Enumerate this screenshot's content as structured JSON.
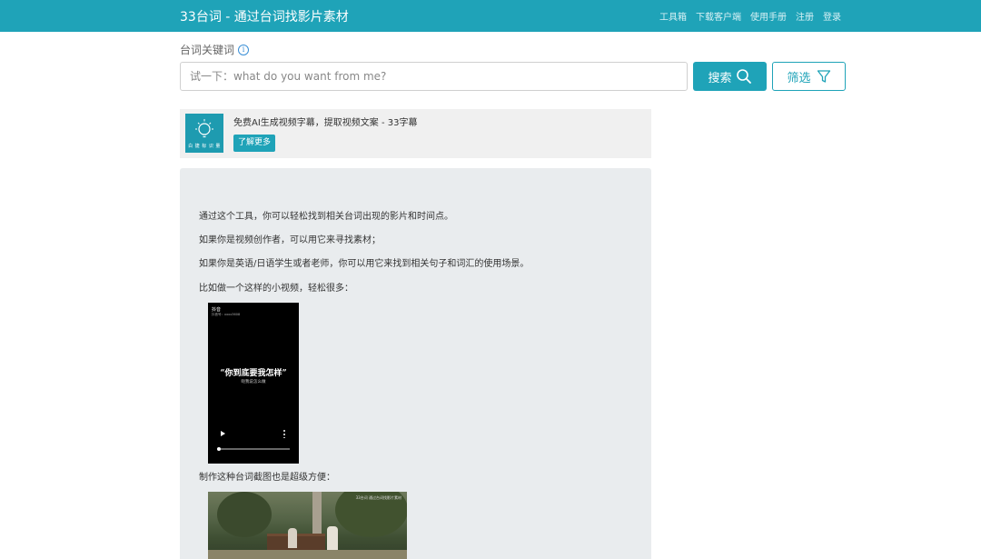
{
  "header": {
    "brand": "33台词 - 通过台词找影片素材",
    "nav": [
      "工具箱",
      "下载客户端",
      "使用手册",
      "注册",
      "登录"
    ]
  },
  "search": {
    "label": "台词关键词",
    "placeholder": "试一下：what do you want from me?",
    "search_button": "搜索",
    "filter_button": "筛选"
  },
  "ad": {
    "text": "免费AI生成视频字幕，提取视频文案 - 33字幕",
    "button": "了解更多",
    "logo_text": "白 捷 标 识 量"
  },
  "intro": {
    "lines": [
      "通过这个工具，你可以轻松找到相关台词出现的影片和时间点。",
      "如果你是视频创作者，可以用它来寻找素材；",
      "如果你是英语/日语学生或者老师，你可以用它来找到相关句子和词汇的使用场景。",
      "比如做一个这样的小视频，轻松很多："
    ],
    "caption2": "制作这种台词截图也是超级方便："
  },
  "phone_video": {
    "app": "抖音",
    "account": "抖音号：xxxx3608",
    "quote": "“你到底要我怎样”",
    "subtitle": "呃我说怎么做"
  },
  "scene_watermark": "33台词 通过台词找影片素材",
  "colors": {
    "accent": "#1fa3b8",
    "panel": "#e9ecee",
    "ad_bg": "#f0f0f0"
  }
}
